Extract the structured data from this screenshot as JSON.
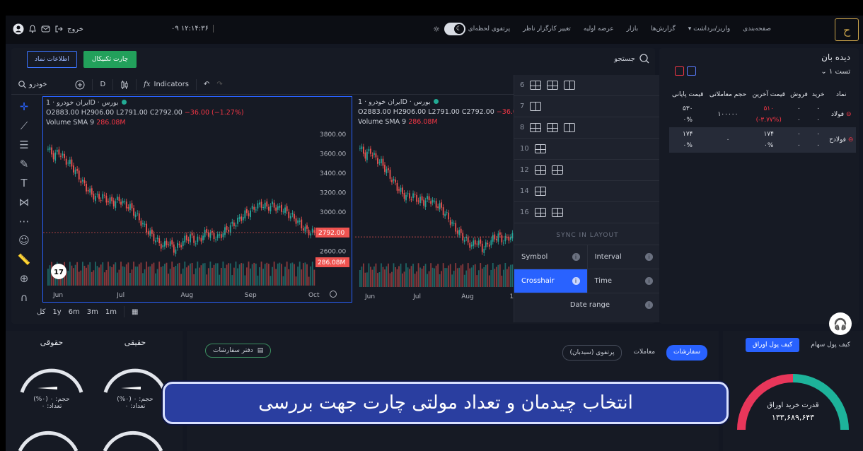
{
  "topnav": {
    "logout": "خروج",
    "clock": "۰۹ ۱۲:۱۴:۳۶",
    "menu": [
      "صفحه‌بندی",
      "واریز/برداشت ▾",
      "گزارش‌ها",
      "بازار",
      "عرضه اولیه",
      "تغییر کارگزار ناظر",
      "پرتفوی لحظه‌ای"
    ]
  },
  "chart_panel": {
    "info_button": "اطلاعات نماد",
    "chart_button": "چارت تکنیکال",
    "search_label": "جستجو",
    "toolbar": {
      "symbol": "خودرو",
      "interval": "D",
      "indicators": "Indicators"
    },
    "bottom_ranges": [
      "کل",
      "1y",
      "6m",
      "3m",
      "1m"
    ]
  },
  "chart_data": [
    {
      "type": "candlestick",
      "legend_title": "ایران خودرو · 1D · بورس",
      "ohlc_text": {
        "o": "O2883.00",
        "h": "H2906.00",
        "l": "L2791.00",
        "c": "C2792.00",
        "chg": "−36.00 (−1.27%)"
      },
      "volume_text": "Volume SMA 9",
      "volume_value": "286.08M",
      "y_ticks": [
        "3800.00",
        "3600.00",
        "3400.00",
        "3200.00",
        "3000.00",
        "2600.00"
      ],
      "last_price_label": "2792.00",
      "last_volume_label": "286.08M",
      "x_ticks": [
        "Jun",
        "Jul",
        "Aug",
        "Sep",
        "Oct"
      ],
      "ylim": [
        2400,
        3850
      ],
      "close_path": [
        3650,
        3580,
        3620,
        3540,
        3500,
        3420,
        3330,
        3250,
        3180,
        3150,
        3160,
        3120,
        3100,
        3130,
        3080,
        3050,
        2980,
        2900,
        2820,
        2760,
        2700,
        2650,
        2700,
        2620,
        2660,
        2720,
        2750,
        2700,
        2740,
        2800,
        2760,
        2740,
        2790,
        2840,
        2880,
        2930,
        2980,
        3010,
        3060,
        3080,
        3050,
        3070,
        3040,
        3030,
        2980,
        2940,
        2880,
        2820,
        2792
      ]
    },
    {
      "type": "candlestick",
      "legend_title": "ایران خودرو · 1D · بورس",
      "ohlc_text": {
        "o": "O2883.00",
        "h": "H2906.00",
        "l": "L2791.00",
        "c": "C2792.00",
        "chg": "−36.00"
      },
      "volume_text": "Volume SMA 9",
      "volume_value": "286.08M",
      "x_ticks": [
        "Jun",
        "Jul",
        "Aug",
        "1"
      ],
      "ylim": [
        2400,
        3850
      ],
      "close_path": [
        3650,
        3580,
        3620,
        3540,
        3500,
        3420,
        3330,
        3250,
        3180,
        3150,
        3160,
        3120,
        3100,
        3130,
        3080,
        3050,
        2980,
        2900,
        2820,
        2760,
        2700,
        2650,
        2700,
        2620,
        2660,
        2720,
        2750,
        2700,
        2740
      ]
    }
  ],
  "layout_menu": {
    "rows": [
      "6",
      "7",
      "8",
      "10",
      "12",
      "14",
      "16"
    ],
    "sync_title": "SYNC IN LAYOUT",
    "sync": {
      "symbol": "Symbol",
      "interval": "Interval",
      "crosshair": "Crosshair",
      "time": "Time",
      "date_range": "Date range"
    }
  },
  "watchlist": {
    "title": "دیده بان",
    "list_name": "تست ۱",
    "columns": [
      "نماد",
      "خرید",
      "فروش",
      "قیمت آخرین",
      "حجم معاملاتی",
      "قیمت پایانی"
    ],
    "rows": [
      {
        "symbol": "فولاد",
        "buy": "۰",
        "buy2": "۰",
        "sell": "۰",
        "sell2": "۰",
        "last": "۵۱۰",
        "last2": "(۳.۷۷%-)",
        "volume": "۱۰۰۰۰۰",
        "close": "۵۳۰",
        "close2": "۰%"
      },
      {
        "symbol": "فولادح",
        "buy": "۰",
        "buy2": "۰",
        "sell": "۰",
        "sell2": "۰",
        "last": "۱۷۴",
        "last2": "۰%",
        "volume": "۰",
        "close": "۱۷۴",
        "close2": "۰%"
      }
    ]
  },
  "gauges": [
    {
      "title": "حقیقی",
      "volume": "حجم: ۰ (۰%)",
      "count": "تعداد: ۰"
    },
    {
      "title": "حقوقی",
      "volume": "حجم: ۰ (۰%)",
      "count": "تعداد: ۰"
    }
  ],
  "orders": {
    "tabs": [
      "سفارشات",
      "معاملات",
      "پرتفوی (سبدبان)"
    ],
    "order_book": "دفتر سفارشات"
  },
  "wallet": {
    "tabs": [
      "کیف پول سهام",
      "کیف پول اوراق"
    ],
    "label": "قدرت خرید اوراق",
    "value": "۱۳۳,۶۸۹,۶۴۳"
  },
  "caption": "انتخاب چیدمان و تعداد مولتی چارت جهت بررسی"
}
